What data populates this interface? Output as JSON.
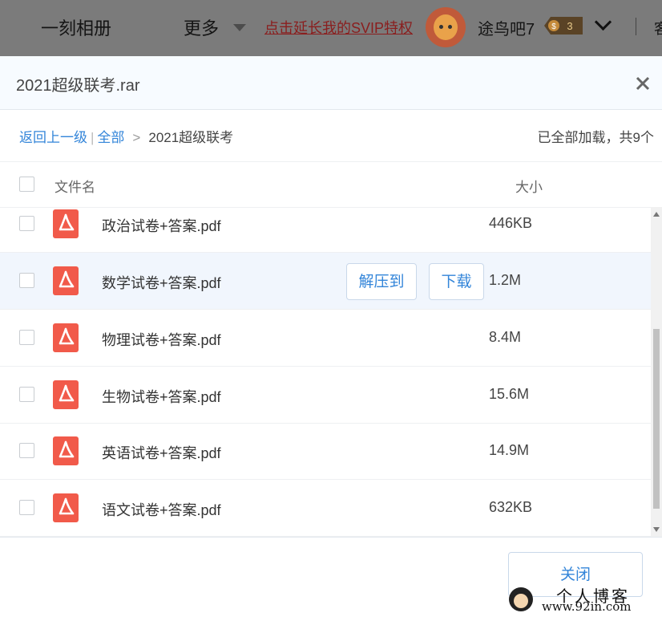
{
  "topbar": {
    "album": "一刻相册",
    "more": "更多",
    "svip_link": "点击延长我的SVIP特权",
    "username": "途鸟吧7",
    "level_badge": "3",
    "cut_text": "客"
  },
  "dialog": {
    "title": "2021超级联考.rar",
    "breadcrumb": {
      "back": "返回上一级",
      "sep": "|",
      "all": "全部",
      "arrow": ">",
      "current": "2021超级联考"
    },
    "summary": "已全部加载，共9个",
    "header": {
      "name": "文件名",
      "size": "大小"
    },
    "files": [
      {
        "name": "政治试卷+答案.pdf",
        "size": "446KB"
      },
      {
        "name": "数学试卷+答案.pdf",
        "size": "1.2M"
      },
      {
        "name": "物理试卷+答案.pdf",
        "size": "8.4M"
      },
      {
        "name": "生物试卷+答案.pdf",
        "size": "15.6M"
      },
      {
        "name": "英语试卷+答案.pdf",
        "size": "14.9M"
      },
      {
        "name": "语文试卷+答案.pdf",
        "size": "632KB"
      }
    ],
    "row_actions": {
      "extract": "解压到",
      "download": "下载"
    },
    "close_button": "关闭"
  },
  "watermark": {
    "text1": "个人博客",
    "text2": "www.92in.com"
  },
  "colors": {
    "link": "#3385d9",
    "pdf": "#f15a4a",
    "highlight": "#f1f6fd"
  }
}
